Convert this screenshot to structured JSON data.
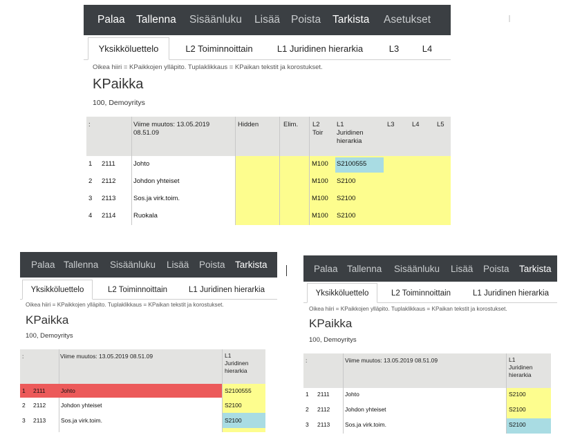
{
  "toolbar": {
    "items": [
      "Palaa",
      "Tallenna",
      "Sisäänluku",
      "Lisää",
      "Poista",
      "Tarkista",
      "Asetukset"
    ]
  },
  "tabs": [
    "Yksikköluettelo",
    "L2 Toiminnoittain",
    "L1 Juridinen hierarkia",
    "L3",
    "L4"
  ],
  "hint": "Oikea hiiri = KPaikkojen ylläpito. Tuplaklikkaus = KPaikan tekstit ja korostukset.",
  "page": {
    "title": "KPaikka",
    "company": "100, Demoyritys"
  },
  "table_top": {
    "headers": {
      "sort": ":",
      "last_change_l1": "Viime muutos: 13.05.2019",
      "last_change_l2": "08.51.09",
      "hidden": "Hidden",
      "elim": "Elim.",
      "l2_l1": "L2",
      "l2_l2": "Toir",
      "l1_l1": "L1",
      "l1_l2": "Juridinen",
      "l1_l3": "hierarkia",
      "l3": "L3",
      "l4": "L4",
      "l5": "L5"
    },
    "rows": [
      {
        "n": "1",
        "code": "2111",
        "name": "Johto",
        "l2": "M100",
        "l1": "S2100555"
      },
      {
        "n": "2",
        "code": "2112",
        "name": "Johdon yhteiset",
        "l2": "M100",
        "l1": "S2100"
      },
      {
        "n": "3",
        "code": "2113",
        "name": "Sos.ja virk.toim.",
        "l2": "M100",
        "l1": "S2100"
      },
      {
        "n": "4",
        "code": "2114",
        "name": "Ruokala",
        "l2": "M100",
        "l1": "S2100"
      }
    ]
  },
  "table_small": {
    "headers": {
      "sort": ":",
      "last_change": "Viime muutos: 13.05.2019 08.51.09",
      "l1_l1": "L1",
      "l1_l2": "Juridinen",
      "l1_l3": "hierarkia"
    }
  },
  "table_left_rows": [
    {
      "n": "1",
      "code": "2111",
      "name": "Johto",
      "l1": "S2100555"
    },
    {
      "n": "2",
      "code": "2112",
      "name": "Johdon yhteiset",
      "l1": "S2100"
    },
    {
      "n": "3",
      "code": "2113",
      "name": "Sos.ja virk.toim.",
      "l1": "S2100"
    }
  ],
  "table_right_rows": [
    {
      "n": "1",
      "code": "2111",
      "name": "Johto",
      "l1": "S2100"
    },
    {
      "n": "2",
      "code": "2112",
      "name": "Johdon yhteiset",
      "l1": "S2100"
    },
    {
      "n": "3",
      "code": "2113",
      "name": "Sos.ja virk.toim.",
      "l1": "S2100"
    }
  ],
  "colors": {
    "toolbar_bg": "#3b3f43",
    "header_bg": "#e3e3e1",
    "yellow_cell": "#fdfd8e",
    "cyan_cell": "#a9dce3",
    "red_row": "#ec5a5a"
  }
}
